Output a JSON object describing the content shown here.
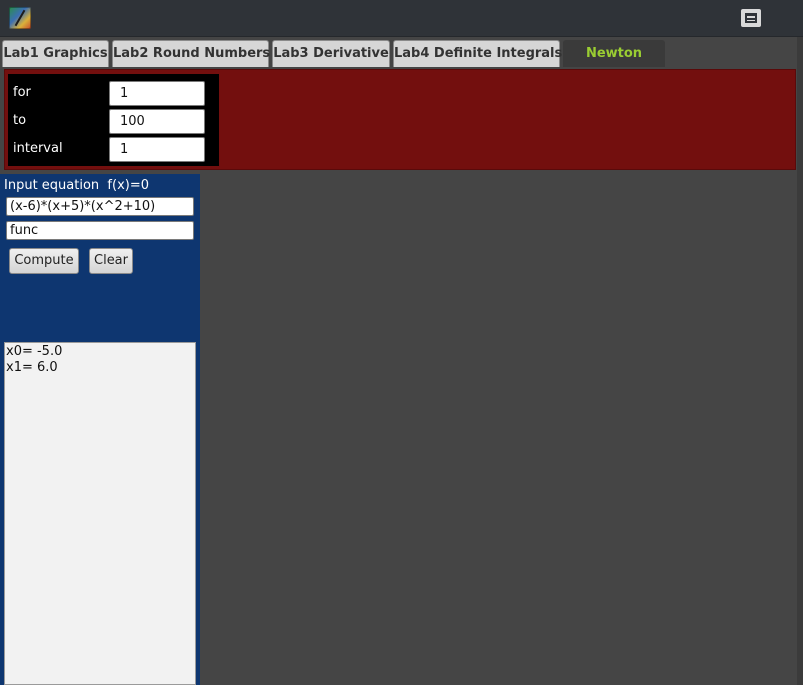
{
  "tabs": [
    {
      "label": "Lab1 Graphics"
    },
    {
      "label": "Lab2 Round Numbers"
    },
    {
      "label": "Lab3 Derivative"
    },
    {
      "label": "Lab4 Definite Integrals"
    },
    {
      "label": "Newton",
      "active": true
    }
  ],
  "params": {
    "for": {
      "label": "for",
      "value": "1"
    },
    "to": {
      "label": "to",
      "value": "100"
    },
    "interval": {
      "label": "interval",
      "value": "1"
    }
  },
  "equation": {
    "label": "Input equation  f(x)=0",
    "expression": "(x-6)*(x+5)*(x^2+10)",
    "function_name": "func"
  },
  "buttons": {
    "compute": "Compute",
    "clear": "Clear"
  },
  "output": {
    "lines": [
      "x0= -5.0",
      "x1= 6.0"
    ]
  },
  "colors": {
    "background": "#454545",
    "header_panel": "#730f0e",
    "side_panel": "#0e3670",
    "active_tab_text": "#9acd32"
  },
  "icons": {
    "app": "app-icon",
    "window_control": "restore-icon"
  }
}
